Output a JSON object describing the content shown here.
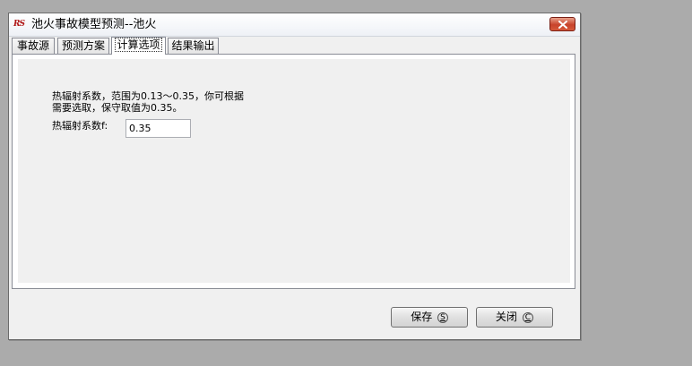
{
  "window": {
    "title": "池火事故模型预测--池火",
    "icon_text": "RS",
    "close_icon": "close-x-icon"
  },
  "tabs": [
    {
      "label": "事故源",
      "active": false
    },
    {
      "label": "预测方案",
      "active": false
    },
    {
      "label": "计算选项",
      "active": true
    },
    {
      "label": "结果输出",
      "active": false
    }
  ],
  "calc_options": {
    "description_line1": "热辐射系数，范围为0.13～0.35，你可根据",
    "description_line2": "需要选取，保守取值为0.35。",
    "coefficient_label": "热辐射系数f:",
    "coefficient_value": "0.35"
  },
  "buttons": {
    "save_label": "保存",
    "save_key": "S",
    "close_label": "关闭",
    "close_key": "C"
  },
  "colors": {
    "desktop": "#ababab",
    "window_bg": "#f0f0f0",
    "close_button": "#c8432b"
  }
}
